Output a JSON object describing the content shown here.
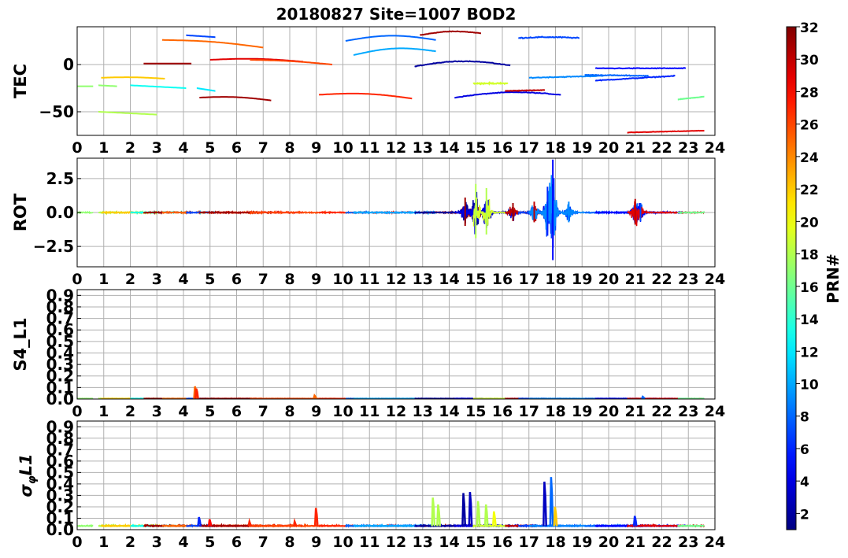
{
  "chart_data": {
    "type": "line",
    "title": "20180827 Site=1007 BOD2",
    "colorbar": {
      "label": "PRN#",
      "range": [
        1,
        32
      ],
      "ticks": [
        2,
        4,
        6,
        8,
        10,
        12,
        14,
        16,
        18,
        20,
        22,
        24,
        26,
        28,
        30,
        32
      ],
      "colormap": "jet"
    },
    "x_ticks": [
      0,
      1,
      2,
      3,
      4,
      5,
      6,
      7,
      8,
      9,
      10,
      11,
      12,
      13,
      14,
      15,
      16,
      17,
      18,
      19,
      20,
      21,
      22,
      23,
      24
    ],
    "xlim": [
      0,
      24
    ],
    "grid": true,
    "panels": [
      {
        "id": "tec",
        "ylabel": "TEC",
        "ylim": [
          -75,
          40
        ],
        "yticks": [
          0,
          -50
        ],
        "ytick_labels": [
          "0",
          "−50"
        ],
        "tracks": [
          {
            "prn": 17,
            "x0": 0.0,
            "x1": 0.6,
            "y0": -23,
            "y1": -23,
            "amp": 0,
            "noise": 0
          },
          {
            "prn": 17,
            "x0": 0.8,
            "x1": 1.5,
            "y0": -22,
            "y1": -23,
            "amp": 0,
            "noise": 0
          },
          {
            "prn": 18,
            "x0": 0.8,
            "x1": 3.0,
            "y0": -50,
            "y1": -53,
            "amp": 0,
            "noise": 0
          },
          {
            "prn": 22,
            "x0": 0.9,
            "x1": 3.3,
            "y0": -14,
            "y1": -15,
            "amp": 1,
            "noise": 0
          },
          {
            "prn": 13,
            "x0": 2.0,
            "x1": 4.1,
            "y0": -22,
            "y1": -25,
            "amp": 0,
            "noise": 0
          },
          {
            "prn": 12,
            "x0": 4.5,
            "x1": 5.2,
            "y0": -25,
            "y1": -28,
            "amp": 0,
            "noise": 0
          },
          {
            "prn": 31,
            "x0": 2.5,
            "x1": 4.3,
            "y0": 1,
            "y1": 1,
            "amp": 0,
            "noise": 0
          },
          {
            "prn": 25,
            "x0": 3.2,
            "x1": 7.0,
            "y0": 26,
            "y1": 18,
            "amp": 2,
            "noise": 0
          },
          {
            "prn": 7,
            "x0": 4.1,
            "x1": 5.2,
            "y0": 31,
            "y1": 29,
            "amp": 0,
            "noise": 0
          },
          {
            "prn": 29,
            "x0": 5.0,
            "x1": 8.5,
            "y0": 5,
            "y1": 3,
            "amp": 2,
            "noise": 0
          },
          {
            "prn": 31,
            "x0": 4.6,
            "x1": 7.3,
            "y0": -35,
            "y1": -38,
            "amp": 2,
            "noise": 0
          },
          {
            "prn": 26,
            "x0": 6.5,
            "x1": 9.6,
            "y0": 5,
            "y1": 0,
            "amp": 1,
            "noise": 0
          },
          {
            "prn": 27,
            "x0": 9.1,
            "x1": 12.6,
            "y0": -32,
            "y1": -36,
            "amp": 3,
            "noise": 0
          },
          {
            "prn": 8,
            "x0": 10.1,
            "x1": 13.5,
            "y0": 25,
            "y1": 26,
            "amp": 5,
            "noise": 0
          },
          {
            "prn": 10,
            "x0": 10.4,
            "x1": 13.5,
            "y0": 10,
            "y1": 14,
            "amp": 5,
            "noise": 0
          },
          {
            "prn": 31,
            "x0": 12.9,
            "x1": 15.2,
            "y0": 31,
            "y1": 33,
            "amp": 3,
            "noise": 0.5
          },
          {
            "prn": 2,
            "x0": 12.7,
            "x1": 16.3,
            "y0": -2,
            "y1": -1,
            "amp": 5,
            "noise": 0.5
          },
          {
            "prn": 4,
            "x0": 14.2,
            "x1": 18.2,
            "y0": -35,
            "y1": -32,
            "amp": 4,
            "noise": 0.5
          },
          {
            "prn": 19,
            "x0": 14.9,
            "x1": 16.2,
            "y0": -20,
            "y1": -20,
            "amp": 0,
            "noise": 0.8
          },
          {
            "prn": 30,
            "x0": 16.1,
            "x1": 17.6,
            "y0": -28,
            "y1": -27,
            "amp": 0,
            "noise": 0.5
          },
          {
            "prn": 7,
            "x0": 16.6,
            "x1": 18.9,
            "y0": 28,
            "y1": 28,
            "amp": 1,
            "noise": 0.8
          },
          {
            "prn": 9,
            "x0": 17.0,
            "x1": 19.8,
            "y0": -14,
            "y1": -12,
            "amp": 0,
            "noise": 0.6
          },
          {
            "prn": 8,
            "x0": 19.1,
            "x1": 21.5,
            "y0": -11,
            "y1": -12,
            "amp": 0,
            "noise": 0.6
          },
          {
            "prn": 6,
            "x0": 19.5,
            "x1": 22.5,
            "y0": -17,
            "y1": -12,
            "amp": 0,
            "noise": 0.6
          },
          {
            "prn": 5,
            "x0": 19.5,
            "x1": 22.9,
            "y0": -4,
            "y1": -4,
            "amp": 0,
            "noise": 0.6
          },
          {
            "prn": 29,
            "x0": 20.7,
            "x1": 23.6,
            "y0": -72,
            "y1": -70,
            "amp": 0,
            "noise": 0.3
          },
          {
            "prn": 16,
            "x0": 22.6,
            "x1": 23.6,
            "y0": -37,
            "y1": -34,
            "amp": 0,
            "noise": 0.3
          }
        ]
      },
      {
        "id": "rot",
        "ylabel": "ROT",
        "ylim": [
          -4,
          4
        ],
        "yticks": [
          2.5,
          0,
          -2.5
        ],
        "ytick_labels": [
          "2.5",
          "0.0",
          "−2.5"
        ],
        "events": [
          {
            "t": 14.6,
            "amp": 1.1,
            "prn": 31
          },
          {
            "t": 15.0,
            "amp": 2.1,
            "prn": 18
          },
          {
            "t": 15.4,
            "amp": 1.8,
            "prn": 18
          },
          {
            "t": 16.4,
            "amp": 0.7,
            "prn": 31
          },
          {
            "t": 17.2,
            "amp": 0.8,
            "prn": 30
          },
          {
            "t": 17.7,
            "amp": 1.9,
            "prn": 6
          },
          {
            "t": 17.9,
            "amp": 3.9,
            "prn": 5
          },
          {
            "t": 18.5,
            "amp": 0.8,
            "prn": 9
          },
          {
            "t": 21.0,
            "amp": 1.0,
            "prn": 30
          },
          {
            "t": 21.2,
            "amp": 0.7,
            "prn": 7
          }
        ]
      },
      {
        "id": "s4",
        "ylabel": "S4_L1",
        "ylim": [
          0,
          0.95
        ],
        "yticks": [
          0.0,
          0.1,
          0.2,
          0.3,
          0.4,
          0.5,
          0.6,
          0.7,
          0.8,
          0.9
        ],
        "ytick_labels": [
          "0.0",
          "0.1",
          "0.2",
          "0.3",
          "0.4",
          "0.5",
          "0.6",
          "0.7",
          "0.8",
          "0.9"
        ],
        "spikes": [
          {
            "t": 4.45,
            "h": 0.11,
            "prn": 25
          },
          {
            "t": 4.5,
            "h": 0.09,
            "prn": 27
          },
          {
            "t": 8.95,
            "h": 0.03,
            "prn": 25
          },
          {
            "t": 21.3,
            "h": 0.02,
            "prn": 8
          }
        ]
      },
      {
        "id": "sigma",
        "ylabel": "σ_φ L1",
        "ylim": [
          0,
          0.95
        ],
        "yticks": [
          0.0,
          0.1,
          0.2,
          0.3,
          0.4,
          0.5,
          0.6,
          0.7,
          0.8,
          0.9
        ],
        "ytick_labels": [
          "0.0",
          "0.1",
          "0.2",
          "0.3",
          "0.4",
          "0.5",
          "0.6",
          "0.7",
          "0.8",
          "0.9"
        ],
        "spikes": [
          {
            "t": 4.6,
            "h": 0.11,
            "prn": 6
          },
          {
            "t": 5.0,
            "h": 0.09,
            "prn": 28
          },
          {
            "t": 6.5,
            "h": 0.07,
            "prn": 27
          },
          {
            "t": 8.2,
            "h": 0.07,
            "prn": 27
          },
          {
            "t": 9.0,
            "h": 0.19,
            "prn": 27
          },
          {
            "t": 13.4,
            "h": 0.28,
            "prn": 18
          },
          {
            "t": 13.6,
            "h": 0.22,
            "prn": 18
          },
          {
            "t": 14.55,
            "h": 0.32,
            "prn": 2
          },
          {
            "t": 14.8,
            "h": 0.33,
            "prn": 3
          },
          {
            "t": 15.1,
            "h": 0.25,
            "prn": 18
          },
          {
            "t": 15.4,
            "h": 0.22,
            "prn": 18
          },
          {
            "t": 15.7,
            "h": 0.16,
            "prn": 20
          },
          {
            "t": 17.6,
            "h": 0.42,
            "prn": 3
          },
          {
            "t": 17.85,
            "h": 0.46,
            "prn": 8
          },
          {
            "t": 18.0,
            "h": 0.2,
            "prn": 22
          },
          {
            "t": 21.0,
            "h": 0.12,
            "prn": 6
          }
        ]
      }
    ]
  }
}
